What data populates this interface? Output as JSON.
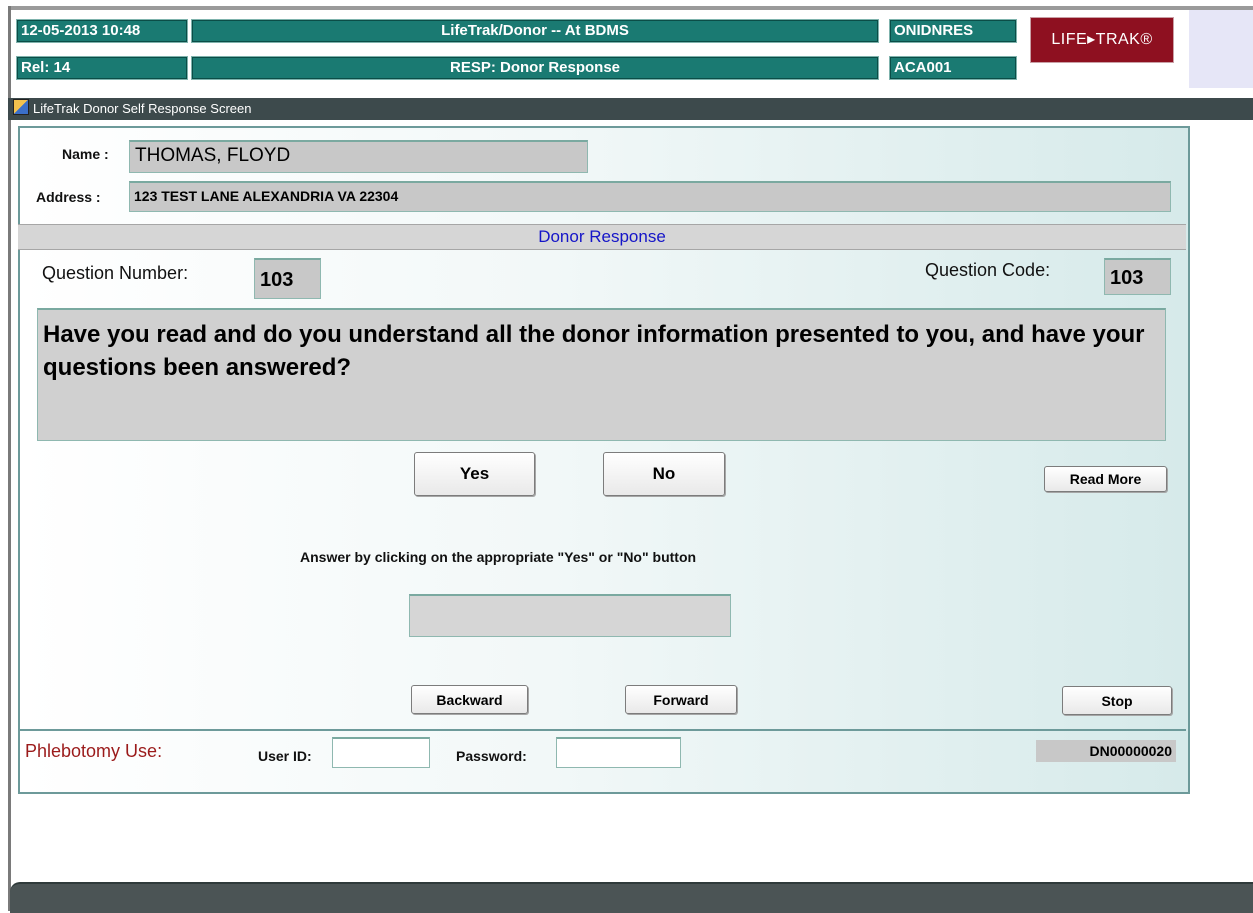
{
  "header": {
    "datetime": "12-05-2013 10:48",
    "app_title": "LifeTrak/Donor -- At BDMS",
    "program_code": "ONIDNRES",
    "release": "Rel: 14",
    "screen_title": "RESP: Donor Response",
    "station_code": "ACA001",
    "logo_text": "LIFE▸TRAK®"
  },
  "window": {
    "title": "LifeTrak Donor Self Response Screen"
  },
  "donor": {
    "name_label": "Name :",
    "name_value": "THOMAS, FLOYD",
    "address_label": "Address :",
    "address_value": "123 TEST LANE  ALEXANDRIA VA 22304"
  },
  "section": {
    "title": "Donor Response"
  },
  "question": {
    "number_label": "Question Number:",
    "number_value": "103",
    "code_label": "Question Code:",
    "code_value": "103",
    "text": "Have you read and do you understand all the donor information presented to you, and have your questions been answered?"
  },
  "buttons": {
    "yes": "Yes",
    "no": "No",
    "read_more": "Read More",
    "backward": "Backward",
    "forward": "Forward",
    "stop": "Stop"
  },
  "instruction": "Answer by clicking on the appropriate \"Yes\"  or  \"No\" button",
  "answer_value": "",
  "phlebotomy": {
    "label": "Phlebotomy Use:",
    "user_id_label": "User ID:",
    "user_id_value": "",
    "password_label": "Password:",
    "password_value": "",
    "record_id": "DN00000020"
  },
  "colors": {
    "header_teal": "#1a7a72",
    "logo_red": "#8e1020",
    "section_blue": "#1515c8",
    "phlebotomy_red": "#9b1b1b"
  }
}
